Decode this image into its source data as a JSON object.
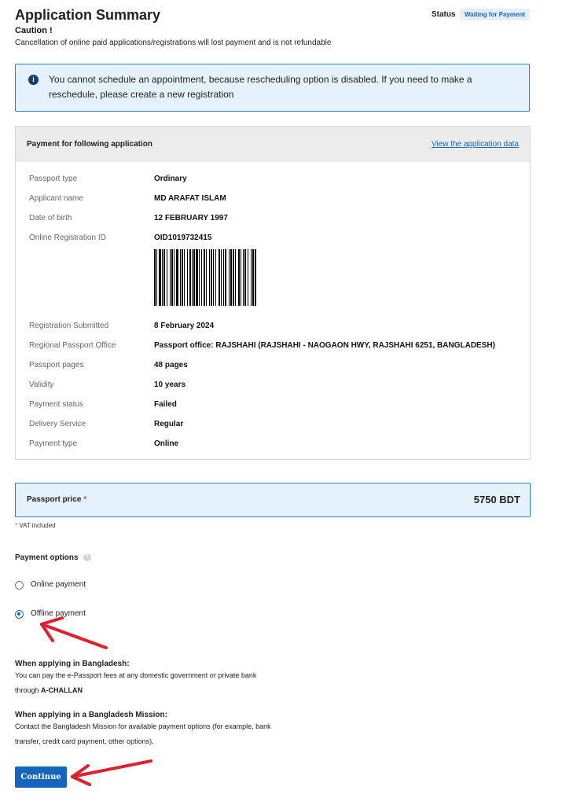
{
  "header": {
    "title": "Application Summary",
    "caution_title": "Caution !",
    "caution_text": "Cancellation of online paid applications/registrations will lost payment and is not refundable",
    "status_label": "Status",
    "status_badge": "Waiting for Payment"
  },
  "info_box": {
    "icon": "info-icon",
    "text": "You cannot schedule an appointment, because rescheduling option is disabled. If you need to make a reschedule, please create a new registration"
  },
  "panel": {
    "title": "Payment for following application",
    "link": "View the application data",
    "rows": [
      {
        "label": "Passport type",
        "value": "Ordinary"
      },
      {
        "label": "Applicant name",
        "value": "MD ARAFAT ISLAM"
      },
      {
        "label": "Date of birth",
        "value": "12 FEBRUARY 1997"
      },
      {
        "label": "Online Registration ID",
        "value": "OID1019732415"
      },
      {
        "label": "Registration Submitted",
        "value": "8 February 2024"
      },
      {
        "label": "Regional Passport Office",
        "value": "Passport office: RAJSHAHI (RAJSHAHI - NAOGAON HWY, RAJSHAHI 6251, BANGLADESH)"
      },
      {
        "label": "Passport pages",
        "value": "48 pages"
      },
      {
        "label": "Validity",
        "value": "10 years"
      },
      {
        "label": "Payment status",
        "value": "Failed"
      },
      {
        "label": "Delivery Service",
        "value": "Regular"
      },
      {
        "label": "Payment type",
        "value": "Online"
      }
    ]
  },
  "price": {
    "label": "Passport price",
    "asterisk": "*",
    "value": "5750 BDT",
    "vat_note": "VAT included"
  },
  "payment_options": {
    "title": "Payment options",
    "options": [
      {
        "label": "Online payment",
        "checked": false
      },
      {
        "label": "Offline payment",
        "checked": true
      }
    ]
  },
  "bangladesh": {
    "title": "When applying in Bangladesh:",
    "line1": "You can pay the e-Passport fees at any domestic government or private bank",
    "line2_prefix": "through ",
    "line2_bold": "A-CHALLAN"
  },
  "mission": {
    "title": "When applying in a Bangladesh Mission:",
    "line1": "Contact the Bangladesh Mission for available payment options (for example, bank",
    "line2": "transfer, credit card payment, other options)."
  },
  "continue_label": "Continue",
  "colors": {
    "primary": "#1565c0",
    "info_bg": "#e6f2fb",
    "annotation_red": "#e0202e"
  }
}
